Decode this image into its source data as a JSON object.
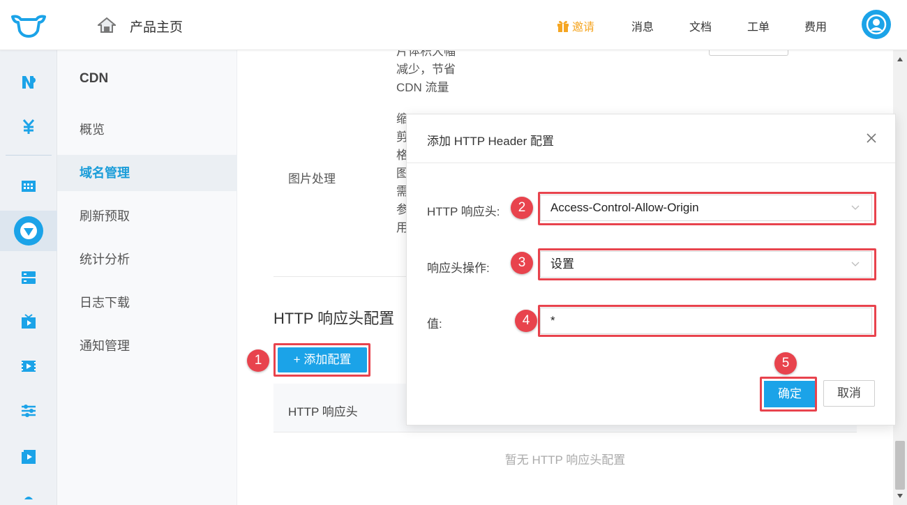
{
  "header": {
    "home_label": "产品主页",
    "nav": {
      "invite": "邀请",
      "messages": "消息",
      "docs": "文档",
      "tickets": "工单",
      "fees": "费用"
    }
  },
  "subnav": {
    "title": "CDN",
    "items": [
      {
        "label": "概览",
        "active": false
      },
      {
        "label": "域名管理",
        "active": true
      },
      {
        "label": "刷新预取",
        "active": false
      },
      {
        "label": "统计分析",
        "active": false
      },
      {
        "label": "日志下载",
        "active": false
      },
      {
        "label": "通知管理",
        "active": false
      }
    ]
  },
  "main": {
    "feature_desc_lines": [
      "片体积大幅",
      "减少，节省",
      "CDN 流量"
    ],
    "img_proc_lines": [
      "缩",
      "剪",
      "格",
      "图",
      "需",
      "参",
      "用"
    ],
    "img_proc_label": "图片处理",
    "section_title": "HTTP 响应头配置",
    "add_button": "+  添加配置",
    "table_header": "HTTP 响应头",
    "empty_text": "暂无 HTTP 响应头配置"
  },
  "modal": {
    "title": "添加 HTTP Header 配置",
    "fields": {
      "header_label": "HTTP 响应头:",
      "header_value": "Access-Control-Allow-Origin",
      "operation_label": "响应头操作:",
      "operation_value": "设置",
      "value_label": "值:",
      "value_value": "*"
    },
    "ok_button": "确定",
    "cancel_button": "取消"
  },
  "annotations": [
    "1",
    "2",
    "3",
    "4",
    "5"
  ],
  "colors": {
    "accent": "#1ba3e8",
    "highlight": "#e8434d",
    "invite": "#f5a623"
  }
}
